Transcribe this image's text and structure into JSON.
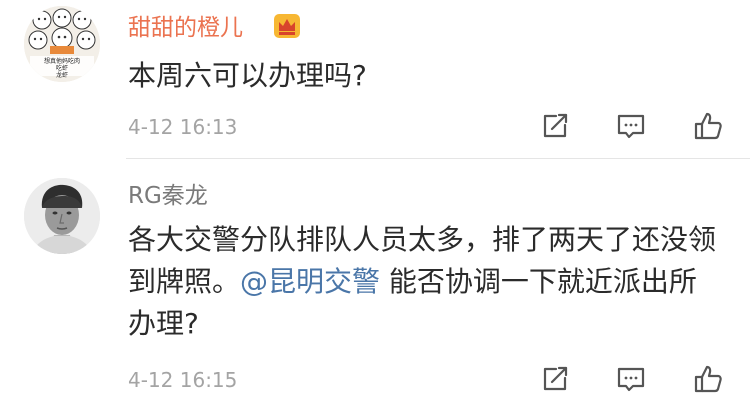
{
  "comments": [
    {
      "username": "甜甜的橙儿",
      "badge": "crown-vip-icon",
      "text": "本周六可以办理吗?",
      "time": "4-12 16:13",
      "avatar_caption_line1": "想真他妈吃肉",
      "avatar_caption_line2": "吃虾",
      "avatar_caption_line3": "龙虾"
    },
    {
      "username": "RG秦龙",
      "text_before": "各大交警分队排队人员太多，排了两天了还没领到牌照。",
      "mention": "@昆明交警",
      "text_after": " 能否协调一下就近派出所办理?",
      "time": "4-12 16:15"
    }
  ],
  "actions": {
    "share_icon": "share-icon",
    "comment_icon": "comment-icon",
    "like_icon": "thumbs-up-icon"
  },
  "colors": {
    "vip_name": "#eb7350",
    "normal_name": "#7a7a7a",
    "mention": "#4a76a8",
    "meta": "#a4a4a4"
  }
}
